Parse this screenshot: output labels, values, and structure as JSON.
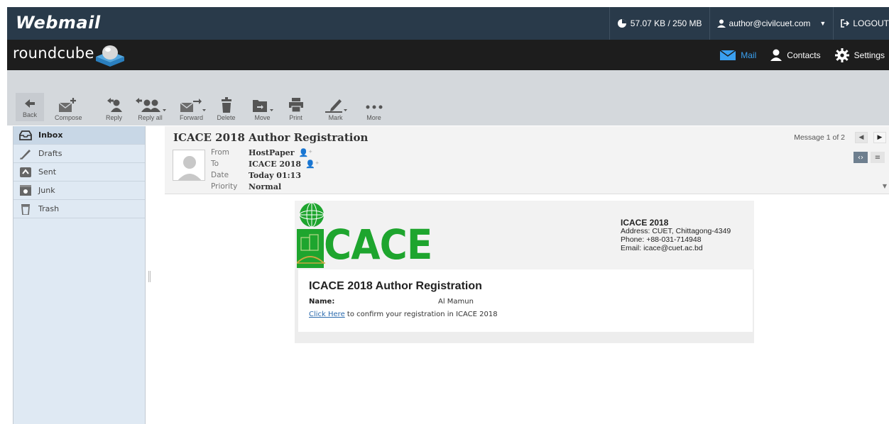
{
  "topbar": {
    "brand": "Webmail",
    "quota": "57.07 KB / 250 MB",
    "user": "author@civilcuet.com",
    "logout": "LOGOUT"
  },
  "rc": {
    "logo_text": "roundcube",
    "nav": [
      {
        "label": "Mail",
        "icon": "mail-icon",
        "active": true
      },
      {
        "label": "Contacts",
        "icon": "contacts-icon"
      },
      {
        "label": "Settings",
        "icon": "settings-gear-icon"
      }
    ]
  },
  "toolbar": {
    "back": "Back",
    "compose": "Compose",
    "reply": "Reply",
    "reply_all": "Reply all",
    "forward": "Forward",
    "delete": "Delete",
    "move": "Move",
    "print": "Print",
    "mark": "Mark",
    "more": "More"
  },
  "folders": [
    {
      "label": "Inbox",
      "icon": "inbox-icon",
      "selected": true
    },
    {
      "label": "Drafts",
      "icon": "drafts-icon"
    },
    {
      "label": "Sent",
      "icon": "sent-icon"
    },
    {
      "label": "Junk",
      "icon": "junk-icon"
    },
    {
      "label": "Trash",
      "icon": "trash-icon"
    }
  ],
  "message": {
    "subject": "ICACE 2018 Author Registration",
    "from_label": "From",
    "from": "HostPaper",
    "to_label": "To",
    "to": "ICACE 2018",
    "date_label": "Date",
    "date": "Today 01:13",
    "priority_label": "Priority",
    "priority": "Normal",
    "counter": "Message 1 of 2"
  },
  "email": {
    "logo_text": "CACE",
    "org": "ICACE 2018",
    "address": "Address: CUET, Chittagong-4349",
    "phone": "Phone: +88-031-714948",
    "email": "Email: icace@cuet.ac.bd",
    "title": "ICACE 2018 Author Registration",
    "name_label": "Name:",
    "name_value": "Al Mamun",
    "link_text": "Click Here",
    "confirm_text": " to confirm your registration in ICACE 2018"
  },
  "colors": {
    "topbar": "#293a4a",
    "rcbar": "#1d1d1d",
    "accent": "#3aa0f0",
    "logo_green": "#1ea52e"
  }
}
